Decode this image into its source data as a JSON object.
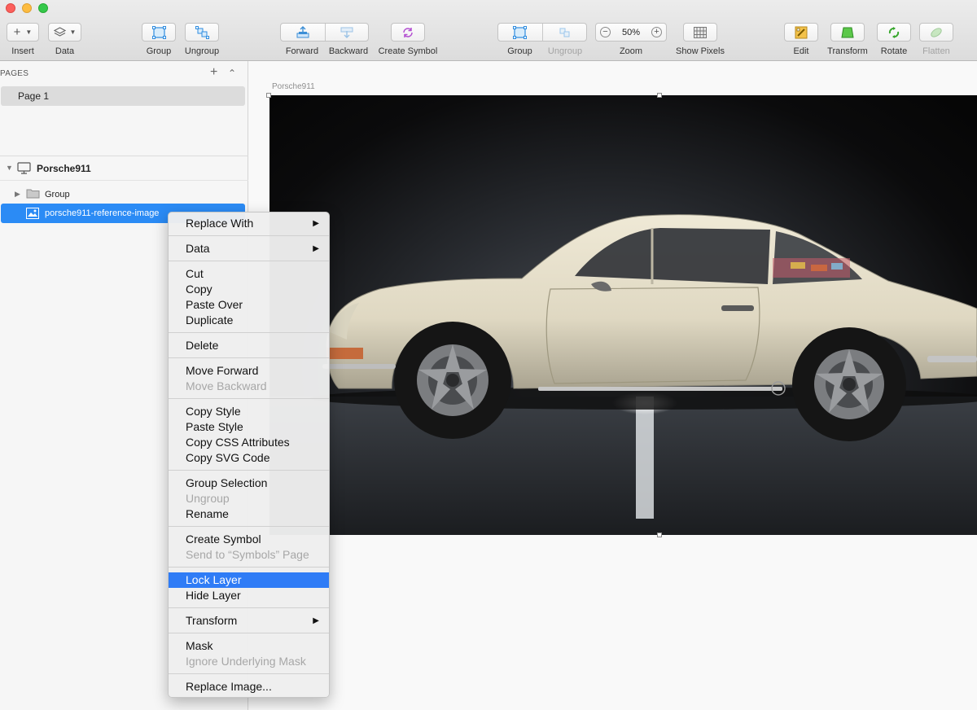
{
  "toolbar": {
    "insert": "Insert",
    "data": "Data",
    "group": "Group",
    "ungroup": "Ungroup",
    "forward": "Forward",
    "backward": "Backward",
    "create_symbol": "Create Symbol",
    "group2": "Group",
    "ungroup2": "Ungroup",
    "zoom": "Zoom",
    "zoom_value": "50%",
    "zoom_minus": "−",
    "zoom_plus": "+",
    "show_pixels": "Show Pixels",
    "edit": "Edit",
    "transform": "Transform",
    "rotate": "Rotate",
    "flatten": "Flatten"
  },
  "sidebar": {
    "pages_header": "PAGES",
    "pages": [
      "Page 1"
    ],
    "artboard": "Porsche911",
    "layers": [
      "Group",
      "porsche911-reference-image"
    ]
  },
  "canvas": {
    "artboard_label": "Porsche911"
  },
  "context_menu": {
    "items": [
      {
        "label": "Replace With",
        "disabled": false,
        "submenu": true
      },
      {
        "label": "Data",
        "disabled": false,
        "submenu": true
      },
      {
        "label": "Cut",
        "disabled": false
      },
      {
        "label": "Copy",
        "disabled": false
      },
      {
        "label": "Paste Over",
        "disabled": false
      },
      {
        "label": "Duplicate",
        "disabled": false
      },
      {
        "label": "Delete",
        "disabled": false
      },
      {
        "label": "Move Forward",
        "disabled": false
      },
      {
        "label": "Move Backward",
        "disabled": true
      },
      {
        "label": "Copy Style",
        "disabled": false
      },
      {
        "label": "Paste Style",
        "disabled": false
      },
      {
        "label": "Copy CSS Attributes",
        "disabled": false
      },
      {
        "label": "Copy SVG Code",
        "disabled": false
      },
      {
        "label": "Group Selection",
        "disabled": false
      },
      {
        "label": "Ungroup",
        "disabled": true
      },
      {
        "label": "Rename",
        "disabled": false
      },
      {
        "label": "Create Symbol",
        "disabled": false
      },
      {
        "label": "Send to “Symbols” Page",
        "disabled": true
      },
      {
        "label": "Lock Layer",
        "disabled": false,
        "highlighted": true
      },
      {
        "label": "Hide Layer",
        "disabled": false
      },
      {
        "label": "Transform",
        "disabled": false,
        "submenu": true
      },
      {
        "label": "Mask",
        "disabled": false
      },
      {
        "label": "Ignore Underlying Mask",
        "disabled": true
      },
      {
        "label": "Replace Image...",
        "disabled": false
      }
    ]
  },
  "colors": {
    "selection": "#2b8bf5",
    "menu_highlight": "#2f7cf6",
    "car_body": "#e6e0cc"
  }
}
